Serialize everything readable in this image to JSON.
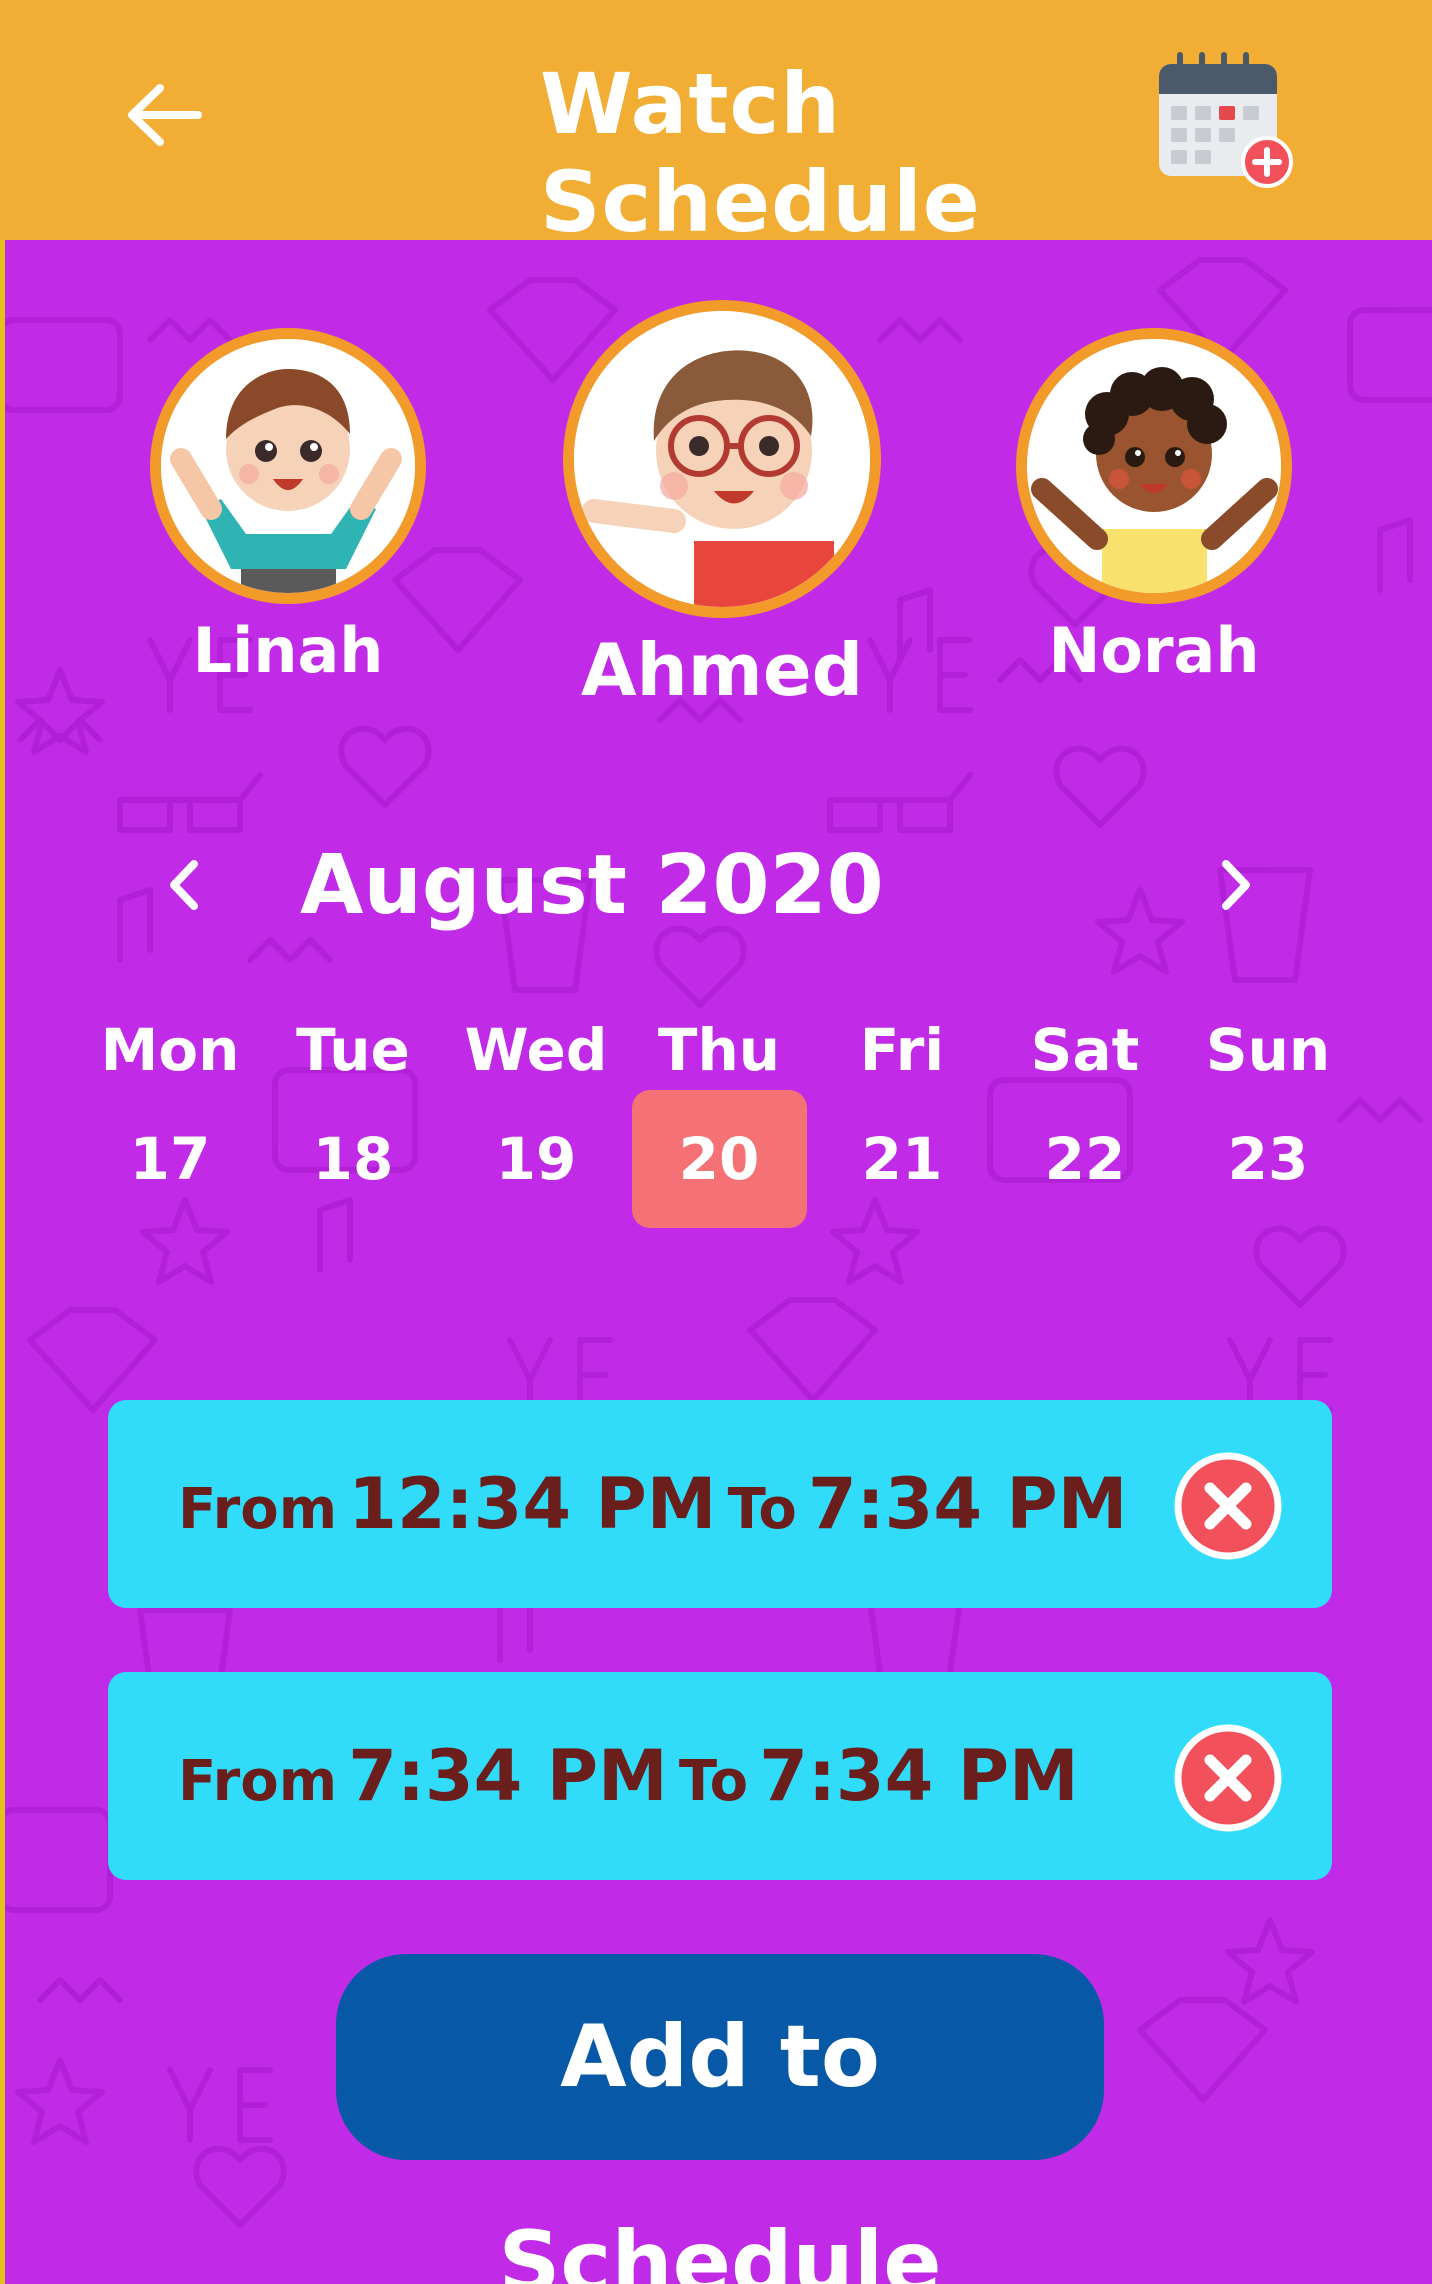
{
  "header": {
    "title": "Watch Schedule",
    "back_icon": "back-arrow-icon",
    "calendar_icon": "calendar-add-icon",
    "bg_color": "#f2ad34"
  },
  "kids": [
    {
      "name": "Linah",
      "avatar": "girl-avatar-icon"
    },
    {
      "name": "Ahmed",
      "avatar": "boy-glasses-avatar-icon"
    },
    {
      "name": "Norah",
      "avatar": "girl-curly-avatar-icon"
    }
  ],
  "calendar": {
    "month_label": "August 2020",
    "prev_icon": "chevron-left-icon",
    "next_icon": "chevron-right-icon",
    "days": [
      {
        "name": "Mon",
        "num": "17"
      },
      {
        "name": "Tue",
        "num": "18"
      },
      {
        "name": "Wed",
        "num": "19"
      },
      {
        "name": "Thu",
        "num": "20"
      },
      {
        "name": "Fri",
        "num": "21"
      },
      {
        "name": "Sat",
        "num": "22"
      },
      {
        "name": "Sun",
        "num": "23"
      }
    ],
    "selected_day": "20",
    "selected_color": "#f67175"
  },
  "schedule": [
    {
      "from_label": "From",
      "from_time": "12:34 PM",
      "to_label": "To",
      "to_time": "7:34 PM",
      "delete_icon": "close-circle-icon"
    },
    {
      "from_label": "From",
      "from_time": "7:34 PM",
      "to_label": "To",
      "to_time": "7:34 PM",
      "delete_icon": "close-circle-icon"
    }
  ],
  "add_button_label": "Add to Schedule",
  "colors": {
    "background": "#c12be8",
    "slot": "#31dcfa",
    "slot_text": "#6b1f1d",
    "button": "#0758a7",
    "delete": "#f2505a"
  }
}
